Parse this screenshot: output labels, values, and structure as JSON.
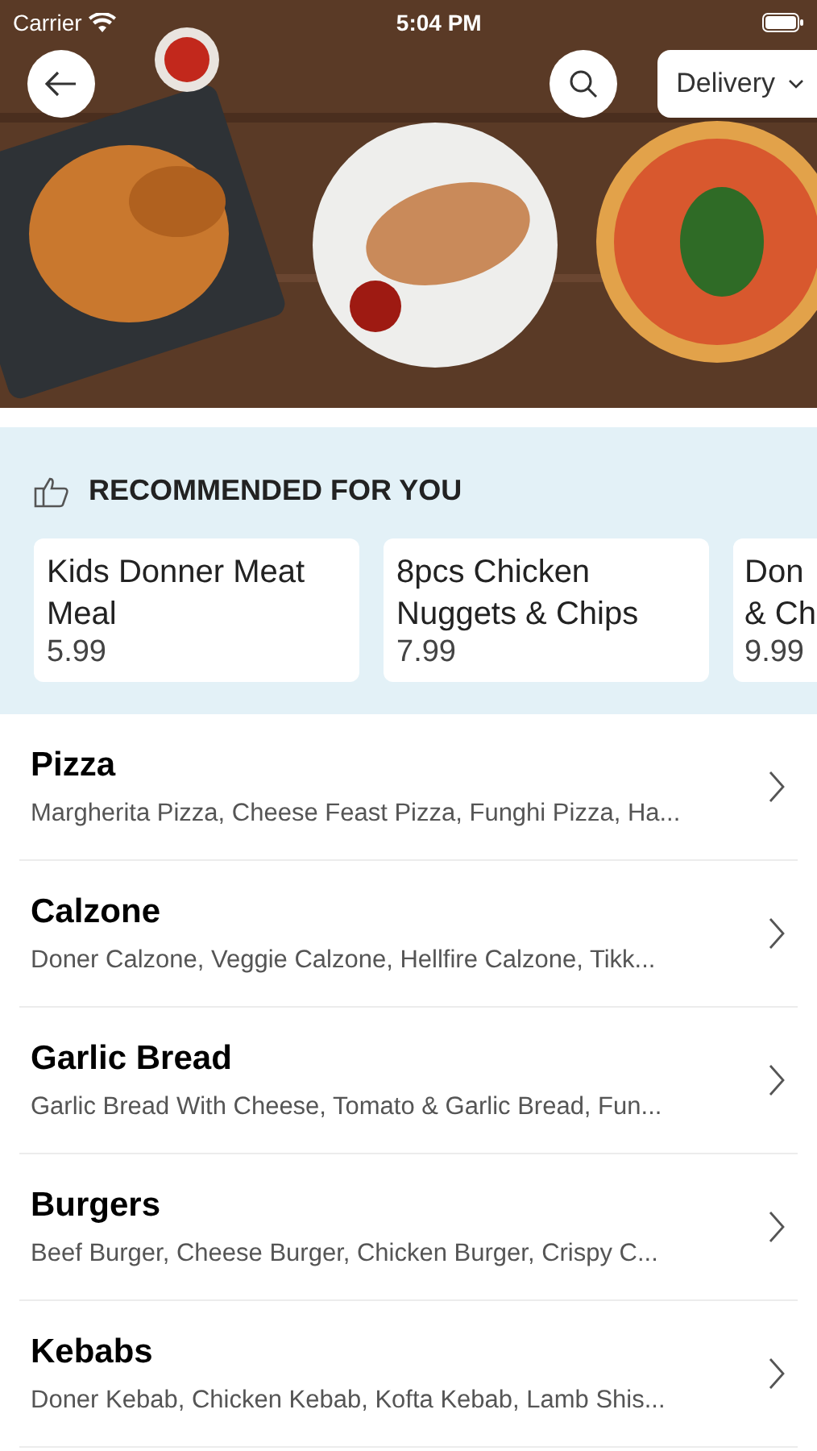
{
  "status_bar": {
    "carrier": "Carrier",
    "time": "5:04 PM"
  },
  "header": {
    "order_mode": "Delivery"
  },
  "recommended": {
    "title": "RECOMMENDED FOR YOU",
    "items": [
      {
        "name": "Kids Donner Meat Meal",
        "price": "5.99"
      },
      {
        "name": "8pcs Chicken Nuggets & Chips",
        "price": "7.99"
      },
      {
        "name": "Don\n& Ch",
        "price": "9.99"
      }
    ]
  },
  "categories": [
    {
      "name": "Pizza",
      "items": "Margherita Pizza, Cheese Feast Pizza, Funghi Pizza, Ha..."
    },
    {
      "name": "Calzone",
      "items": "Doner Calzone, Veggie Calzone, Hellfire Calzone, Tikk..."
    },
    {
      "name": "Garlic Bread",
      "items": "Garlic Bread With Cheese, Tomato & Garlic Bread, Fun..."
    },
    {
      "name": "Burgers",
      "items": "Beef Burger, Cheese Burger, Chicken Burger, Crispy C..."
    },
    {
      "name": "Kebabs",
      "items": "Doner Kebab, Chicken Kebab, Kofta Kebab, Lamb Shis..."
    }
  ]
}
